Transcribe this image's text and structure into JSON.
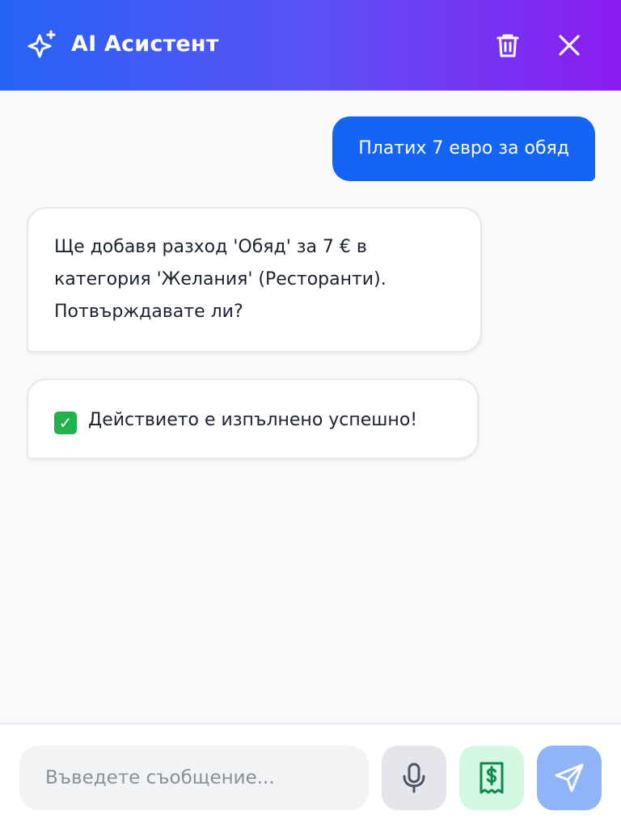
{
  "header": {
    "title": "AI Асистент",
    "icons": [
      "sparkle-icon",
      "trash-icon",
      "close-icon"
    ]
  },
  "messages": [
    {
      "role": "user",
      "text": "Платих 7 евро за обяд"
    },
    {
      "role": "assistant",
      "lines": [
        "Ще добавя разход 'Обяд' за 7 € в",
        "категория 'Желания' (Ресторанти).",
        "Потвърждавате ли?"
      ]
    },
    {
      "role": "assistant",
      "status_icon": "check-icon",
      "text": "Действието е изпълнено успешно!"
    }
  ],
  "composer": {
    "placeholder": "Въведете съобщение...",
    "value": "",
    "buttons": [
      "mic-icon",
      "receipt-icon",
      "send-icon"
    ]
  },
  "colors": {
    "header_gradient_start": "#2563f6",
    "header_gradient_end": "#8b1cf0",
    "user_bubble": "#1464f5",
    "receipt_button_bg": "#d4f7e3",
    "send_button_bg": "#8fb4f9"
  }
}
